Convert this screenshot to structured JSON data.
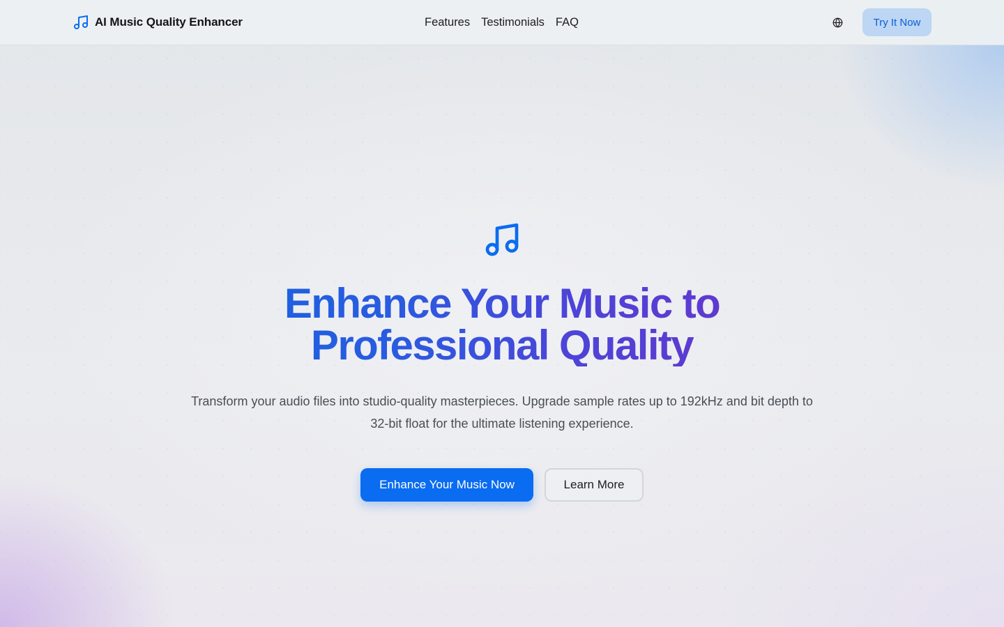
{
  "header": {
    "brand_name": "AI Music Quality Enhancer",
    "brand_icon": "music-note-icon",
    "nav": [
      {
        "label": "Features"
      },
      {
        "label": "Testimonials"
      },
      {
        "label": "FAQ"
      }
    ],
    "language_icon": "globe-icon",
    "cta_label": "Try It Now"
  },
  "hero": {
    "icon": "music-note-icon",
    "title_line1": "Enhance Your Music to",
    "title_line2": "Professional Quality",
    "subtitle": "Transform your audio files into studio-quality masterpieces. Upgrade sample rates up to 192kHz and bit depth to 32-bit float for the ultimate listening experience.",
    "primary_cta": "Enhance Your Music Now",
    "secondary_cta": "Learn More"
  },
  "colors": {
    "accent": "#0a6cf0",
    "title_gradient_start": "#1565e0",
    "title_gradient_end": "#7030c8",
    "try_button_bg": "#bcd6f3"
  }
}
